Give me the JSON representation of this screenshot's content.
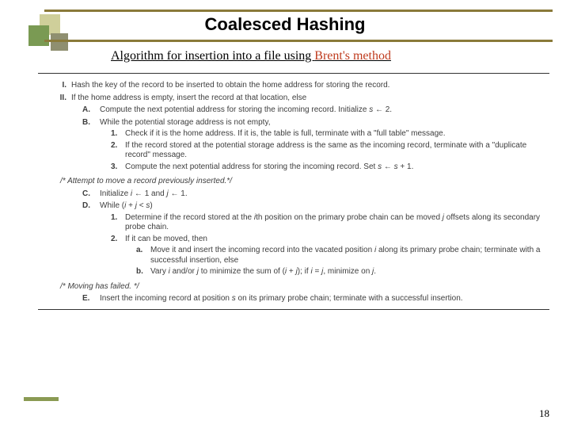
{
  "title": "Coalesced Hashing",
  "subtitle_prefix": "Algorithm for insertion into a file using ",
  "subtitle_brent": "Brent's method",
  "page_number": "18",
  "algo": {
    "I": "Hash the key of the record to be inserted to obtain the home address for storing the record.",
    "II": "If the home address is empty, insert the record at that location, else",
    "A": "Compute the next potential address for storing the incoming record. Initialize s ← 2.",
    "B": "While the potential storage address is not empty,",
    "B1": "Check if it is the home address. If it is, the table is full, terminate with a \"full table\" message.",
    "B2": "If the record stored at the potential storage address is the same as the incoming record, terminate with a \"duplicate record\" message.",
    "B3": "Compute the next potential address for storing the incoming record. Set s ← s + 1.",
    "comment1": "/* Attempt to move a record previously inserted.*/",
    "C": "Initialize i ← 1 and j ← 1.",
    "D": "While (i + j < s)",
    "D1": "Determine if the record stored at the ith position on the primary probe chain can be moved j offsets along its secondary probe chain.",
    "D2": "If it can be moved, then",
    "D2a": "Move it and insert the incoming record into the vacated position i along its primary probe chain; terminate with a successful insertion, else",
    "D2b": "Vary i and/or j to minimize the sum of (i + j); if i = j, minimize on j.",
    "comment2": "/* Moving has failed. */",
    "E": "Insert the incoming record at position s on its primary probe chain; terminate with a successful insertion."
  }
}
